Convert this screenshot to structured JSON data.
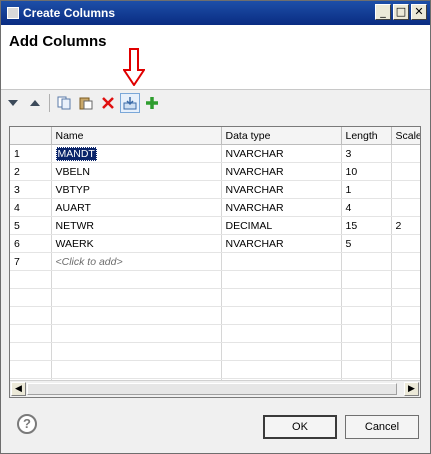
{
  "window": {
    "title": "Create Columns",
    "minimize": "_",
    "maximize": "□",
    "close": "✕"
  },
  "header": {
    "title": "Add Columns"
  },
  "toolbar": {
    "buttons": [
      "move-down-icon",
      "move-up-icon",
      "copy-icon",
      "paste-icon",
      "delete-icon",
      "import-icon",
      "add-icon"
    ]
  },
  "table": {
    "headers": [
      "",
      "Name",
      "Data type",
      "Length",
      "Scale"
    ],
    "rows": [
      {
        "n": "1",
        "name": "MANDT",
        "type": "NVARCHAR",
        "length": "3",
        "scale": ""
      },
      {
        "n": "2",
        "name": "VBELN",
        "type": "NVARCHAR",
        "length": "10",
        "scale": ""
      },
      {
        "n": "3",
        "name": "VBTYP",
        "type": "NVARCHAR",
        "length": "1",
        "scale": ""
      },
      {
        "n": "4",
        "name": "AUART",
        "type": "NVARCHAR",
        "length": "4",
        "scale": ""
      },
      {
        "n": "5",
        "name": "NETWR",
        "type": "DECIMAL",
        "length": "15",
        "scale": "2"
      },
      {
        "n": "6",
        "name": "WAERK",
        "type": "NVARCHAR",
        "length": "5",
        "scale": ""
      },
      {
        "n": "7",
        "name": "<Click to add>",
        "type": "",
        "length": "",
        "scale": ""
      }
    ]
  },
  "scroll": {
    "left": "◀",
    "right": "▶"
  },
  "footer": {
    "help": "?",
    "ok": "OK",
    "cancel": "Cancel"
  },
  "colors": {
    "titlebar": "#0a2c82",
    "arrow": "#e00000",
    "delete": "#e01010",
    "add": "#2e9d2e"
  }
}
